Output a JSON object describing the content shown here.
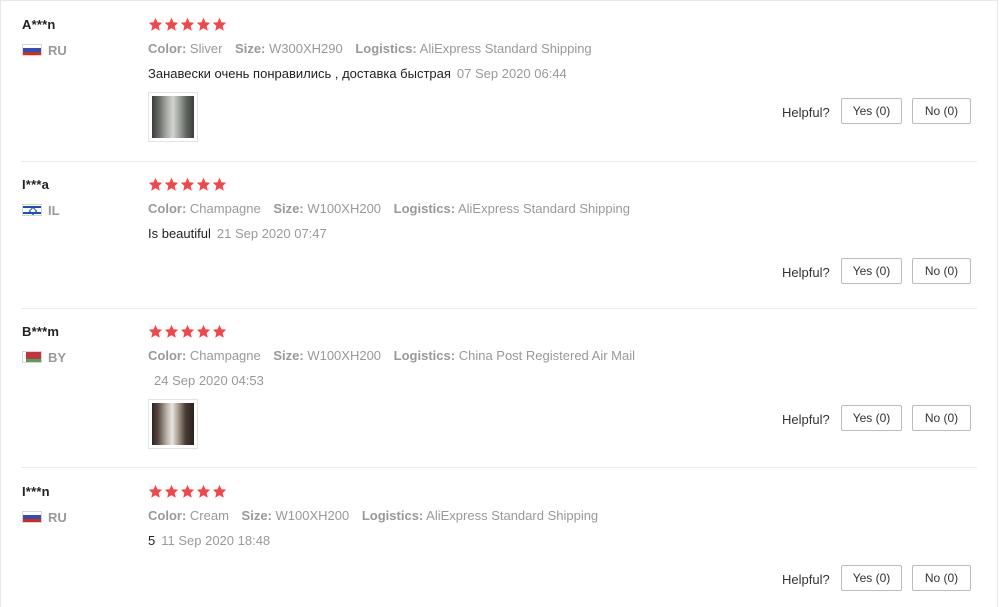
{
  "reviews": [
    {
      "user": "A***n",
      "country": "RU",
      "flag_colors": [
        "#ffffff",
        "#2d4fb8",
        "#d52b1e"
      ],
      "rating": 5,
      "attributes": [
        {
          "key": "Color:",
          "value": "Sliver"
        },
        {
          "key": "Size:",
          "value": "W300XH290"
        },
        {
          "key": "Logistics:",
          "value": "AliExpress Standard Shipping"
        }
      ],
      "feedback": "Занавески очень понравились , доставка быстрая",
      "date": "07 Sep 2020 06:44",
      "has_photo": true,
      "helpful_label": "Helpful?",
      "yes_label": "Yes (0)",
      "no_label": "No (0)"
    },
    {
      "user": "I***a",
      "country": "IL",
      "flag_colors": [
        "#ffffff",
        "#1f4fb3"
      ],
      "rating": 5,
      "attributes": [
        {
          "key": "Color:",
          "value": "Champagne"
        },
        {
          "key": "Size:",
          "value": "W100XH200"
        },
        {
          "key": "Logistics:",
          "value": "AliExpress Standard Shipping"
        }
      ],
      "feedback": "Is beautiful",
      "date": "21 Sep 2020 07:47",
      "has_photo": false,
      "helpful_label": "Helpful?",
      "yes_label": "Yes (0)",
      "no_label": "No (0)"
    },
    {
      "user": "B***m",
      "country": "BY",
      "flag_colors": [
        "#c8313e",
        "#4aa657",
        "#ffffff"
      ],
      "rating": 5,
      "attributes": [
        {
          "key": "Color:",
          "value": "Champagne"
        },
        {
          "key": "Size:",
          "value": "W100XH200"
        },
        {
          "key": "Logistics:",
          "value": "China Post Registered Air Mail"
        }
      ],
      "feedback": "",
      "date": "24 Sep 2020 04:53",
      "has_photo": true,
      "helpful_label": "Helpful?",
      "yes_label": "Yes (0)",
      "no_label": "No (0)"
    },
    {
      "user": "I***n",
      "country": "RU",
      "flag_colors": [
        "#ffffff",
        "#2d4fb8",
        "#d52b1e"
      ],
      "rating": 5,
      "attributes": [
        {
          "key": "Color:",
          "value": "Cream"
        },
        {
          "key": "Size:",
          "value": "W100XH200"
        },
        {
          "key": "Logistics:",
          "value": "AliExpress Standard Shipping"
        }
      ],
      "feedback": "5",
      "date": "11 Sep 2020 18:48",
      "has_photo": false,
      "helpful_label": "Helpful?",
      "yes_label": "Yes (0)",
      "no_label": "No (0)"
    }
  ],
  "star_color": "#f2474a"
}
